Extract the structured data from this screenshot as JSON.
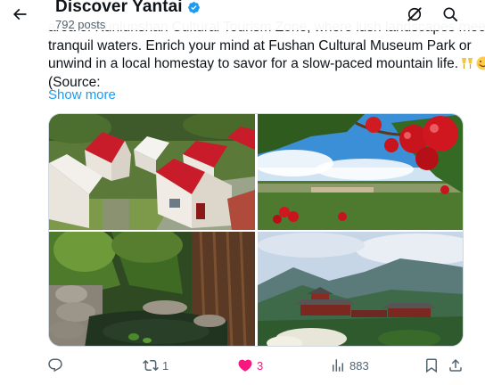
{
  "header": {
    "account_name": "Discover Yantai",
    "post_count": "792 posts"
  },
  "post": {
    "lines": [
      "area of Kunlunshan Cultural Tourism Zone, where lush landscapes meet",
      "tranquil waters. Enrich your mind at Fushan Cultural Museum Park or",
      "unwind in a local homestay to savor for a slow-paced mountain life.",
      "(Source:"
    ],
    "show_more": "Show more"
  },
  "actions": {
    "reply_count": "",
    "repost_count": "1",
    "like_count": "3",
    "views_count": "883"
  },
  "icons": {
    "back": "arrow-left-icon",
    "verified": "verified-badge-icon",
    "grok": "grok-icon",
    "search": "search-icon",
    "reply": "reply-icon",
    "repost": "repost-icon",
    "like": "heart-filled-icon",
    "views": "views-chart-icon",
    "bookmark": "bookmark-icon",
    "share": "share-icon",
    "emoji_1": "clinking-glasses-emoji",
    "emoji_2": "smiling-face-emoji"
  },
  "colors": {
    "accent": "#1d9bf0",
    "like": "#f91880",
    "secondary_text": "#536471"
  }
}
